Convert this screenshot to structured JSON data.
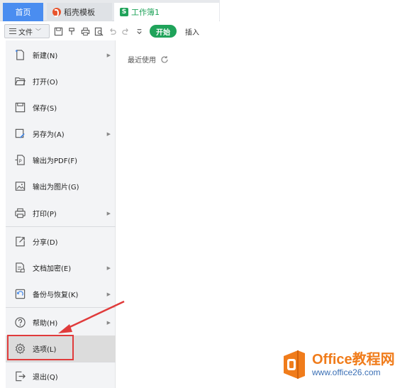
{
  "tabs": {
    "home": "首页",
    "template": "稻壳模板",
    "workbook": "工作簿1",
    "workbook_icon_letter": "S"
  },
  "toolbar": {
    "file_label": "文件",
    "start_label": "开始",
    "insert_label": "插入"
  },
  "file_menu": {
    "items": [
      {
        "label": "新建(N)",
        "icon": "new-file-icon",
        "submenu": true
      },
      {
        "label": "打开(O)",
        "icon": "folder-open-icon",
        "submenu": false
      },
      {
        "label": "保存(S)",
        "icon": "save-icon",
        "submenu": false
      },
      {
        "label": "另存为(A)",
        "icon": "save-as-icon",
        "submenu": true
      },
      {
        "label": "输出为PDF(F)",
        "icon": "export-pdf-icon",
        "submenu": false
      },
      {
        "label": "输出为图片(G)",
        "icon": "export-image-icon",
        "submenu": false
      },
      {
        "label": "打印(P)",
        "icon": "print-icon",
        "submenu": true
      },
      {
        "label": "分享(D)",
        "icon": "share-icon",
        "submenu": false
      },
      {
        "label": "文档加密(E)",
        "icon": "encrypt-icon",
        "submenu": true
      },
      {
        "label": "备份与恢复(K)",
        "icon": "backup-icon",
        "submenu": true
      },
      {
        "label": "帮助(H)",
        "icon": "help-icon",
        "submenu": true
      },
      {
        "label": "选项(L)",
        "icon": "gear-icon",
        "submenu": false
      },
      {
        "label": "退出(Q)",
        "icon": "exit-icon",
        "submenu": false
      }
    ],
    "selected": "选项(L)"
  },
  "recent": {
    "label": "最近使用"
  },
  "watermark": {
    "title": "Office教程网",
    "url": "www.office26.com"
  },
  "colors": {
    "accent_green": "#1fa35a",
    "home_tab_blue": "#4a8df0",
    "highlight_red": "#e03b3b",
    "watermark_orange": "#f07c1b"
  }
}
